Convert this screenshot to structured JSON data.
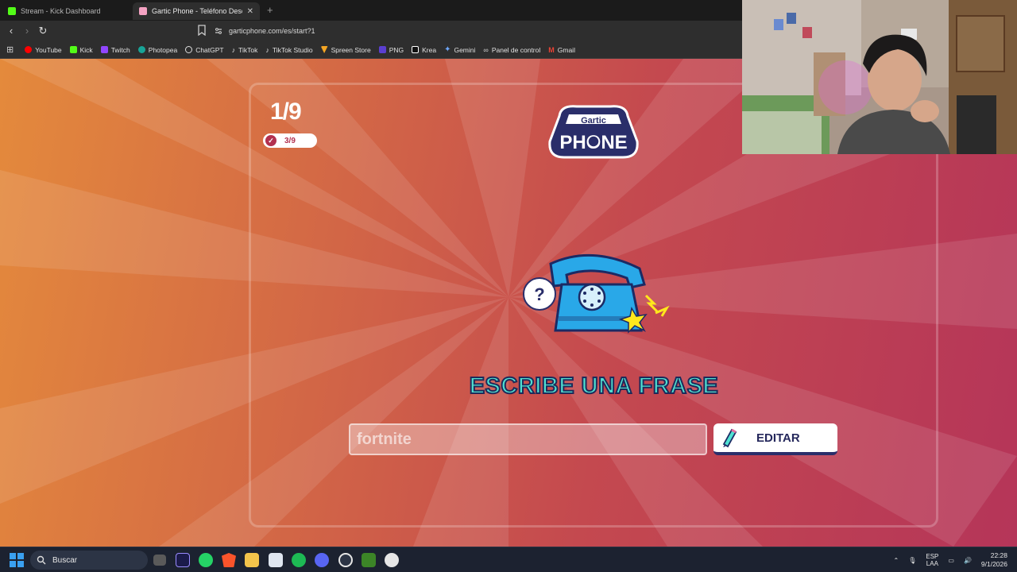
{
  "browser": {
    "tabs": [
      {
        "title": "Stream - Kick Dashboard",
        "favicon_color": "#53fc18",
        "active": false
      },
      {
        "title": "Gartic Phone - Teléfono Descom",
        "favicon_color": "#f4a2c2",
        "active": true
      }
    ],
    "address": "garticphone.com/es/start?1",
    "bookmarks": [
      {
        "label": "YouTube",
        "color": "#ff0000"
      },
      {
        "label": "Kick",
        "color": "#53fc18"
      },
      {
        "label": "Twitch",
        "color": "#9146ff"
      },
      {
        "label": "Photopea",
        "color": "#18a497"
      },
      {
        "label": "ChatGPT",
        "color": "#dddddd"
      },
      {
        "label": "TikTok",
        "color": "#ffffff"
      },
      {
        "label": "TikTok Studio",
        "color": "#ffffff"
      },
      {
        "label": "Spreen Store",
        "color": "#f5a623"
      },
      {
        "label": "PNG",
        "color": "#5b3fd0"
      },
      {
        "label": "Krea",
        "color": "#ffffff"
      },
      {
        "label": "Gemini",
        "color": "#6ea8fe"
      },
      {
        "label": "Panel de control",
        "color": "#cccccc"
      },
      {
        "label": "Gmail",
        "color": "#ea4335"
      }
    ]
  },
  "game": {
    "round": "1/9",
    "done_count": "3/9",
    "logo_line1": "Gartic",
    "logo_line2": "PHONE",
    "prompt_title": "ESCRIBE UNA FRASE",
    "phrase_value": "fortnite",
    "edit_label": "EDITAR",
    "colors": {
      "bg_left": "#e48a3c",
      "bg_right": "#b53559",
      "title": "#4fe1d2",
      "button_text": "#25285c"
    }
  },
  "taskbar": {
    "search_placeholder": "Buscar",
    "lang_line1": "ESP",
    "lang_line2": "LAA",
    "time": "22:28",
    "date": "9/1/2026"
  }
}
